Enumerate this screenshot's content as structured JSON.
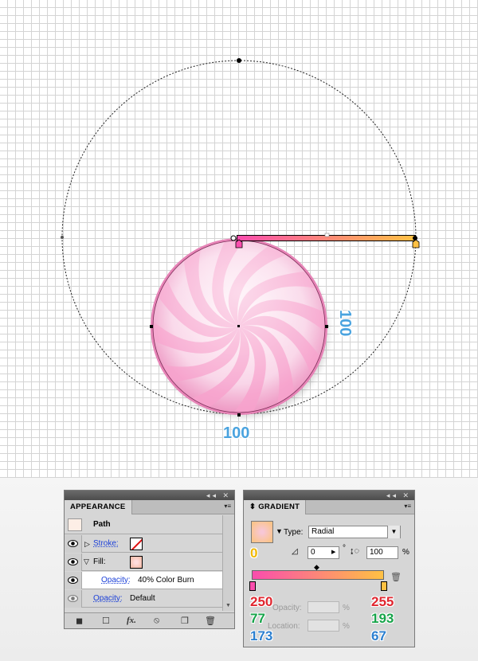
{
  "canvas": {
    "dimension_width": "100",
    "dimension_height": "100"
  },
  "appearance": {
    "tab_label": "APPEARANCE",
    "object_label": "Path",
    "stroke_label": "Stroke:",
    "fill_label": "Fill:",
    "fill_opacity_label": "Opacity:",
    "fill_opacity_value": "40% Color Burn",
    "opacity_label": "Opacity:",
    "opacity_value": "Default"
  },
  "gradient": {
    "tab_label": "GRADIENT",
    "type_label": "Type:",
    "type_value": "Radial",
    "angle_value": "0",
    "aspect_value": "100",
    "percent_sign": "%",
    "degree_sign": "°",
    "active_stop_label": "0",
    "opacity_label": "Opacity:",
    "location_label": "Location:",
    "left_stop": {
      "r": "250",
      "g": "77",
      "b": "173",
      "color": "#fa4dad"
    },
    "right_stop": {
      "r": "255",
      "g": "193",
      "b": "67",
      "color": "#ffc143"
    }
  },
  "colors": {
    "selection": "#000000",
    "dimension_label": "#4aa3df",
    "candy_light": "#fdf3f8",
    "candy_stripe": "#f7a2cd"
  }
}
